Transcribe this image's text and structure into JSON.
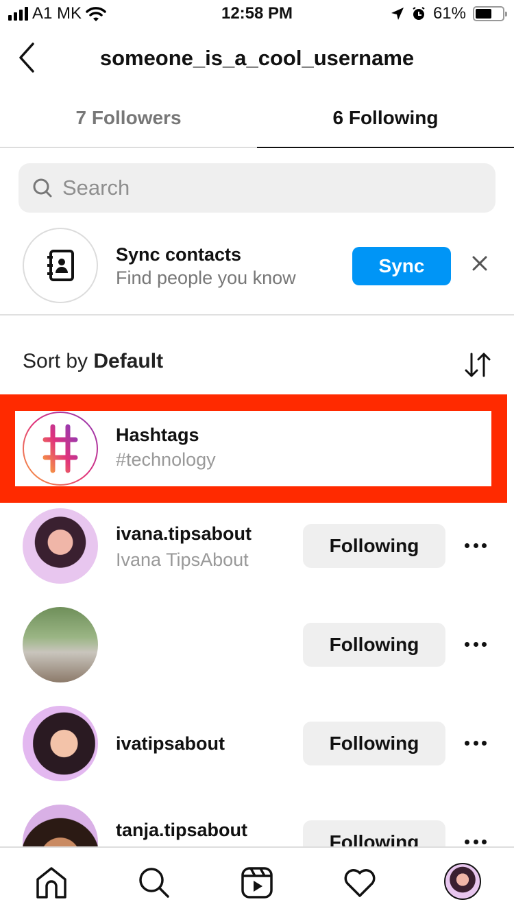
{
  "status_bar": {
    "carrier": "A1 MK",
    "time": "12:58 PM",
    "battery": "61%",
    "battery_level": 0.61
  },
  "header": {
    "title": "someone_is_a_cool_username"
  },
  "tabs": [
    {
      "label": "7 Followers",
      "active": false
    },
    {
      "label": "6 Following",
      "active": true
    }
  ],
  "search": {
    "placeholder": "Search",
    "value": ""
  },
  "sync_contacts": {
    "title": "Sync contacts",
    "subtitle": "Find people you know",
    "button_label": "Sync"
  },
  "sort": {
    "prefix": "Sort by",
    "value": "Default"
  },
  "hashtags": {
    "title": "Hashtags",
    "subtitle": "#technology"
  },
  "following": [
    {
      "username": "ivana.tipsabout",
      "full_name": "Ivana TipsAbout",
      "button": "Following",
      "avatar_color": "#e8c6ef"
    },
    {
      "username": "",
      "full_name": "",
      "button": "Following",
      "avatar_color": "#8aa377"
    },
    {
      "username": "ivatipsabout",
      "full_name": "",
      "button": "Following",
      "avatar_color": "#e3b8f0"
    },
    {
      "username": "tanja.tipsabout",
      "full_name": "",
      "button": "Following",
      "avatar_color": "#d9b0e6"
    }
  ],
  "colors": {
    "accent": "#0095f6",
    "highlight": "#ff2a00"
  },
  "bottom_nav": [
    "home-icon",
    "search-icon",
    "reels-icon",
    "heart-icon",
    "profile-avatar"
  ]
}
